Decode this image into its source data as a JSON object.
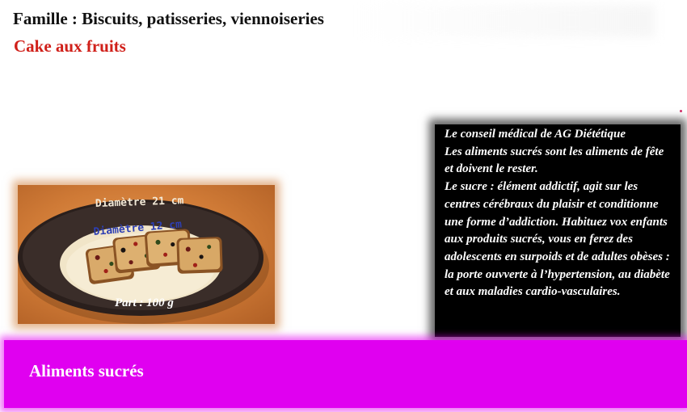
{
  "family_line": "Famille : Biscuits, patisseries, viennoiseries",
  "title": "Cake aux fruits",
  "photo": {
    "outer_diameter_label": "Diamètre 21 cm",
    "inner_diameter_label": "Diamètre 12 cm",
    "portion_label": "Part : 100 g"
  },
  "advice": {
    "heading": "Le conseil médical de AG Diététique",
    "body": "Les aliments sucrés sont les aliments de fête et doivent le rester.\nLe sucre : élément addictif, agit sur les centres cérébraux du plaisir et conditionne une forme d’addiction. Habituez vox enfants aux produits sucrés, vous en ferez des adolescents en surpoids et de adultes obèses : la porte ouvverte à l’hypertension, au diabète et aux maladies cardio-vasculaires."
  },
  "banner": {
    "label": "Aliments sucrés",
    "color": "#e000f0"
  },
  "colors": {
    "title": "#d0201a",
    "advice_background": "#000000"
  }
}
